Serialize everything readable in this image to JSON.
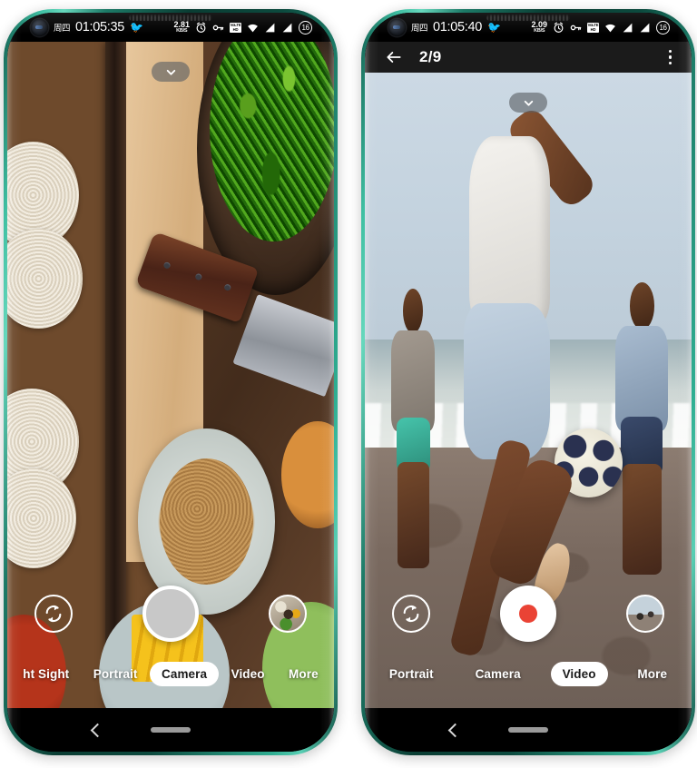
{
  "phones": [
    {
      "id": "camera-phone",
      "frame_color": "#1d7a67",
      "status_bar": {
        "day_label": "周四",
        "time": "01:05:35",
        "app_icon": "bird-icon",
        "net_speed_value": "2.81",
        "net_speed_unit": "KB/S",
        "icons": [
          "alarm-icon",
          "vpn-key-icon",
          "volte-icon",
          "wifi-icon",
          "signal-1-icon",
          "signal-2-icon"
        ],
        "battery_level": "16"
      },
      "viewfinder": {
        "scene": "food-flatlay-noodles-knife-greens",
        "dropdown_icon": "chevron-down-icon"
      },
      "controls": {
        "flip_icon": "camera-flip-icon",
        "shutter_label": "shutter-button",
        "shutter_type": "photo",
        "thumbnail_label": "last-photo-thumbnail"
      },
      "modes": [
        {
          "label": "ht Sight",
          "active": false
        },
        {
          "label": "Portrait",
          "active": false
        },
        {
          "label": "Camera",
          "active": true
        },
        {
          "label": "Video",
          "active": false
        },
        {
          "label": "More",
          "active": false
        }
      ],
      "navbar": {
        "back_icon": "back-chevron-icon",
        "home_icon": "home-pill-icon"
      }
    },
    {
      "id": "gallery-phone",
      "frame_color": "#1d7a67",
      "status_bar": {
        "day_label": "周四",
        "time": "01:05:40",
        "app_icon": "bird-icon",
        "net_speed_value": "2.09",
        "net_speed_unit": "KB/S",
        "icons": [
          "alarm-icon",
          "vpn-key-icon",
          "volte-icon",
          "wifi-icon",
          "signal-1-icon",
          "signal-2-icon"
        ],
        "battery_level": "16"
      },
      "toolbar": {
        "back_icon": "arrow-left-icon",
        "title": "2/9",
        "menu_icon": "more-vertical-icon"
      },
      "viewfinder": {
        "scene": "beach-football-players",
        "dropdown_icon": "chevron-down-icon"
      },
      "controls": {
        "flip_icon": "camera-flip-icon",
        "shutter_label": "record-button",
        "shutter_type": "video",
        "thumbnail_label": "last-photo-thumbnail"
      },
      "modes": [
        {
          "label": "Portrait",
          "active": false
        },
        {
          "label": "Camera",
          "active": false
        },
        {
          "label": "Video",
          "active": true
        },
        {
          "label": "More",
          "active": false
        }
      ],
      "navbar": {
        "back_icon": "back-chevron-icon",
        "home_icon": "home-pill-icon"
      }
    }
  ],
  "colors": {
    "record_red": "#ea4335",
    "active_pill_bg": "#ffffff",
    "active_pill_text": "#1b1b1b",
    "status_bar_bg": "#000000",
    "toolbar_bg": "#1b1b1b"
  }
}
